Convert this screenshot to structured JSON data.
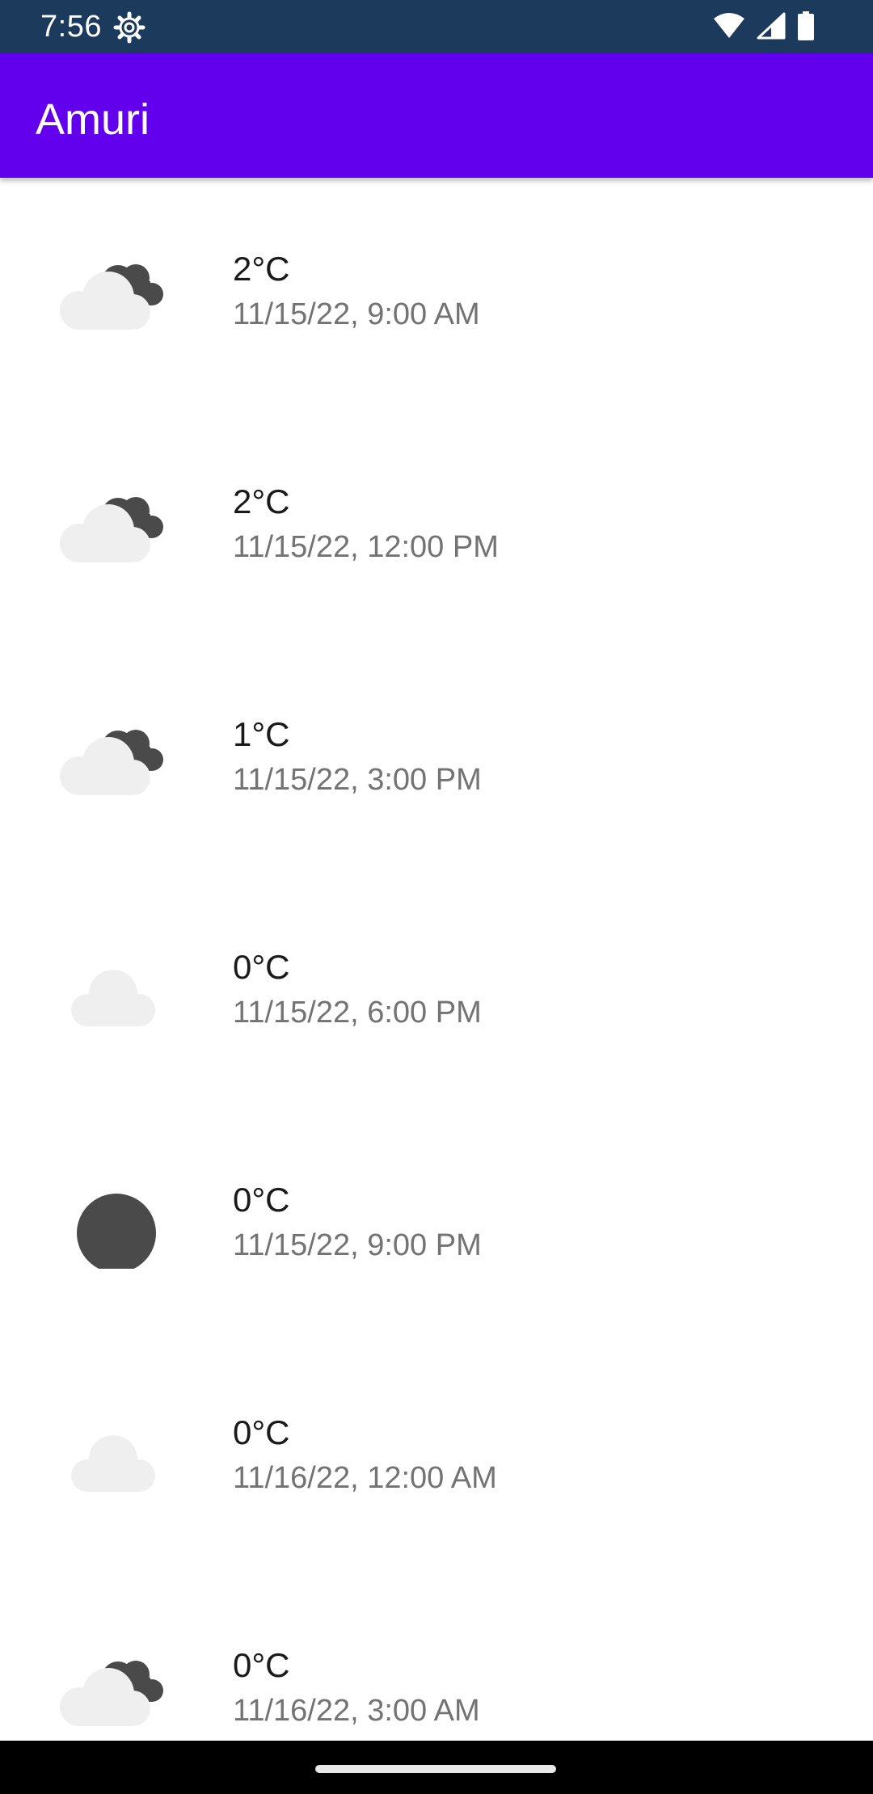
{
  "status_bar": {
    "time": "7:56",
    "icons": [
      "settings-gear-icon",
      "wifi-icon",
      "cellular-signal-icon",
      "battery-icon"
    ]
  },
  "app_bar": {
    "title": "Amuri",
    "color": "#6200ee"
  },
  "forecast": [
    {
      "temperature": "2°C",
      "datetime": "11/15/22, 9:00 AM",
      "icon": "partly-cloudy-night-icon"
    },
    {
      "temperature": "2°C",
      "datetime": "11/15/22, 12:00 PM",
      "icon": "partly-cloudy-night-icon"
    },
    {
      "temperature": "1°C",
      "datetime": "11/15/22, 3:00 PM",
      "icon": "partly-cloudy-night-icon"
    },
    {
      "temperature": "0°C",
      "datetime": "11/15/22, 6:00 PM",
      "icon": "cloud-icon"
    },
    {
      "temperature": "0°C",
      "datetime": "11/15/22, 9:00 PM",
      "icon": "clear-night-moon-icon"
    },
    {
      "temperature": "0°C",
      "datetime": "11/16/22, 12:00 AM",
      "icon": "cloud-icon"
    },
    {
      "temperature": "0°C",
      "datetime": "11/16/22, 3:00 AM",
      "icon": "partly-cloudy-night-icon"
    }
  ]
}
